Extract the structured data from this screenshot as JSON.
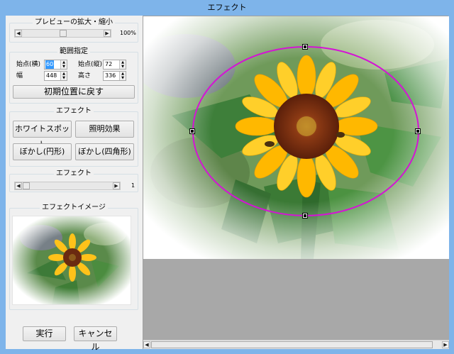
{
  "window": {
    "title": "エフェクト"
  },
  "zoom_group": {
    "title": "プレビューの拡大・縮小",
    "value": "100%"
  },
  "range_group": {
    "title": "範囲指定",
    "start_x_label": "始点(横)",
    "start_x_value": "60",
    "start_y_label": "始点(縦)",
    "start_y_value": "72",
    "width_label": "幅",
    "width_value": "448",
    "height_label": "高さ",
    "height_value": "336",
    "reset_label": "初期位置に戻す"
  },
  "effect_group": {
    "title": "エフェクト",
    "white_spot_label": "ホワイトスポット",
    "lighting_label": "照明効果",
    "blur_circle_label": "ぼかし(円形)",
    "blur_rect_label": "ぼかし(四角形)"
  },
  "strength_group": {
    "title": "エフェクト",
    "value": "1",
    "level": 0.0
  },
  "image_group": {
    "title": "エフェクトイメージ"
  },
  "footer": {
    "run_label": "実行",
    "cancel_label": "キャンセル"
  },
  "icons": {
    "arrow_left": "◀",
    "arrow_right": "▶",
    "spin": "spinner-arrows-icon"
  },
  "colors": {
    "title_bar": "#7eb4ea",
    "ellipse": "#d414d4",
    "petal": "#ffc21a",
    "center": "#6b2a10"
  }
}
